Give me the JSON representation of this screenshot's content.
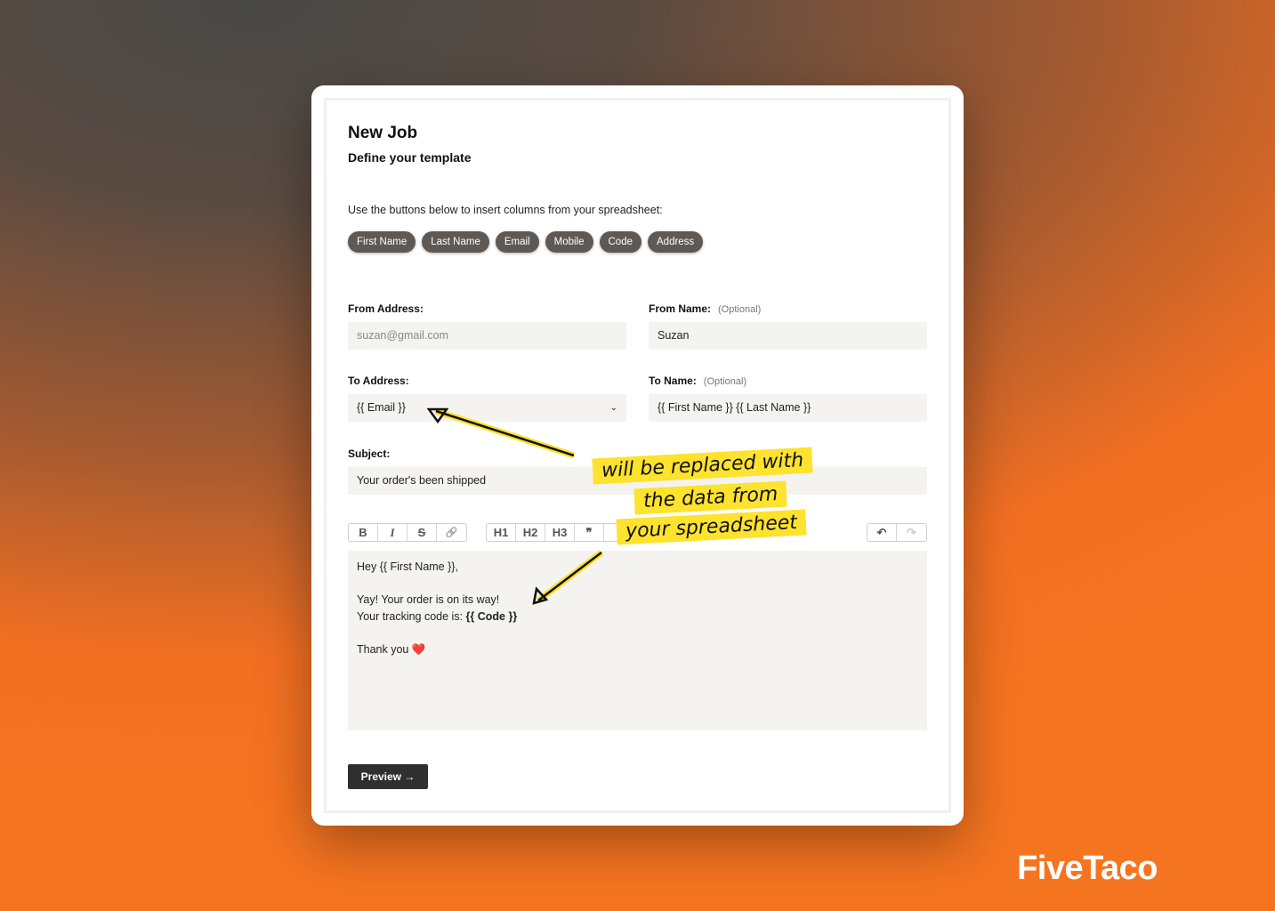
{
  "header": {
    "title": "New Job",
    "subtitle": "Define your template"
  },
  "hint": "Use the buttons below to insert columns from your spreadsheet:",
  "columns": [
    "First Name",
    "Last Name",
    "Email",
    "Mobile",
    "Code",
    "Address"
  ],
  "form": {
    "from_address": {
      "label": "From Address:",
      "placeholder": "suzan@gmail.com"
    },
    "from_name": {
      "label": "From Name:",
      "optional": "(Optional)",
      "value": "Suzan"
    },
    "to_address": {
      "label": "To Address:",
      "value": "{{ Email }}"
    },
    "to_name": {
      "label": "To Name:",
      "optional": "(Optional)",
      "value": "{{ First Name }} {{ Last Name }}"
    },
    "subject": {
      "label": "Subject:",
      "value": "Your order's been shipped"
    }
  },
  "toolbar": {
    "bold": "B",
    "italic": "I",
    "strike": "S",
    "link": "🔗",
    "h1": "H1",
    "h2": "H2",
    "h3": "H3",
    "quote": "❞",
    "undo": "↶",
    "redo": "↷"
  },
  "editor": {
    "line1": "Hey {{ First Name }},",
    "line2": "Yay! Your order is on its way!",
    "line3": "Your tracking code is: ",
    "code": "{{ Code }}",
    "line4": "Thank you",
    "heart": "❤️"
  },
  "preview_label": "Preview →",
  "annotation": [
    "will be replaced with",
    "the data from",
    "your spreadsheet"
  ],
  "brand": "FiveTaco",
  "colors": {
    "chip": "#5f5955",
    "highlight": "#fde22e",
    "button": "#2f2f2f"
  }
}
